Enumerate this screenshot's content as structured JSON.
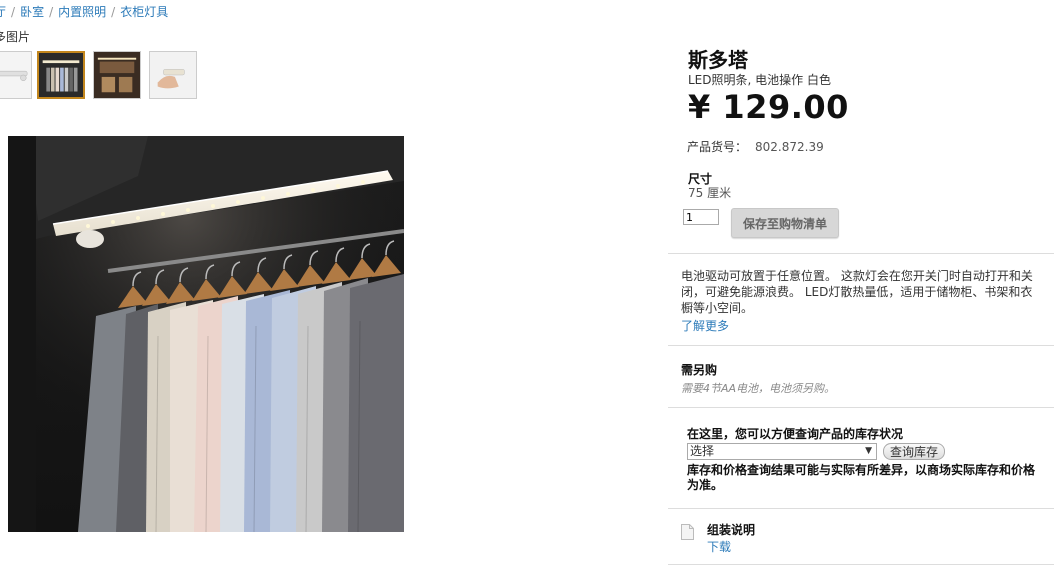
{
  "breadcrumb": {
    "items": [
      "厅",
      "卧室",
      "内置照明",
      "衣柜灯具"
    ]
  },
  "gallery": {
    "more_images_label": "多图片",
    "thumbnails": [
      "thumb-light-strip",
      "thumb-wardrobe-lit",
      "thumb-cabinet-lit",
      "thumb-hand-mounting"
    ],
    "selected_index": 1
  },
  "product": {
    "name": "斯多塔",
    "description": "LED照明条, 电池操作 白色",
    "price": "¥ 129.00",
    "article_label": "产品货号：",
    "article_number": "802.872.39",
    "size_label": "尺寸",
    "size_value": "75 厘米",
    "quantity": "1",
    "save_button": "保存至购物清单"
  },
  "details": {
    "line1": "电池驱动可放置于任意位置。 这款灯会在您开关门时自动打开和关",
    "line2": "闭，可避免能源浪费。 LED灯散热量低，适用于储物柜、书架和衣",
    "line3": "橱等小空间。",
    "learn_more": "了解更多"
  },
  "required": {
    "title": "需另购",
    "note": "需要4节AA电池，电池须另购。"
  },
  "stock": {
    "title": "在这里，您可以方便查询产品的库存状况",
    "select_value": "选择",
    "check_button": "查询库存",
    "note_line1": "库存和价格查询结果可能与实际有所差异，以商场实际库存和价格",
    "note_line2": "为准。"
  },
  "assembly": {
    "title": "组装说明",
    "download": "下载"
  },
  "colors": {
    "link": "#2d7bb9",
    "selected_thumb_border": "#c2861d"
  }
}
